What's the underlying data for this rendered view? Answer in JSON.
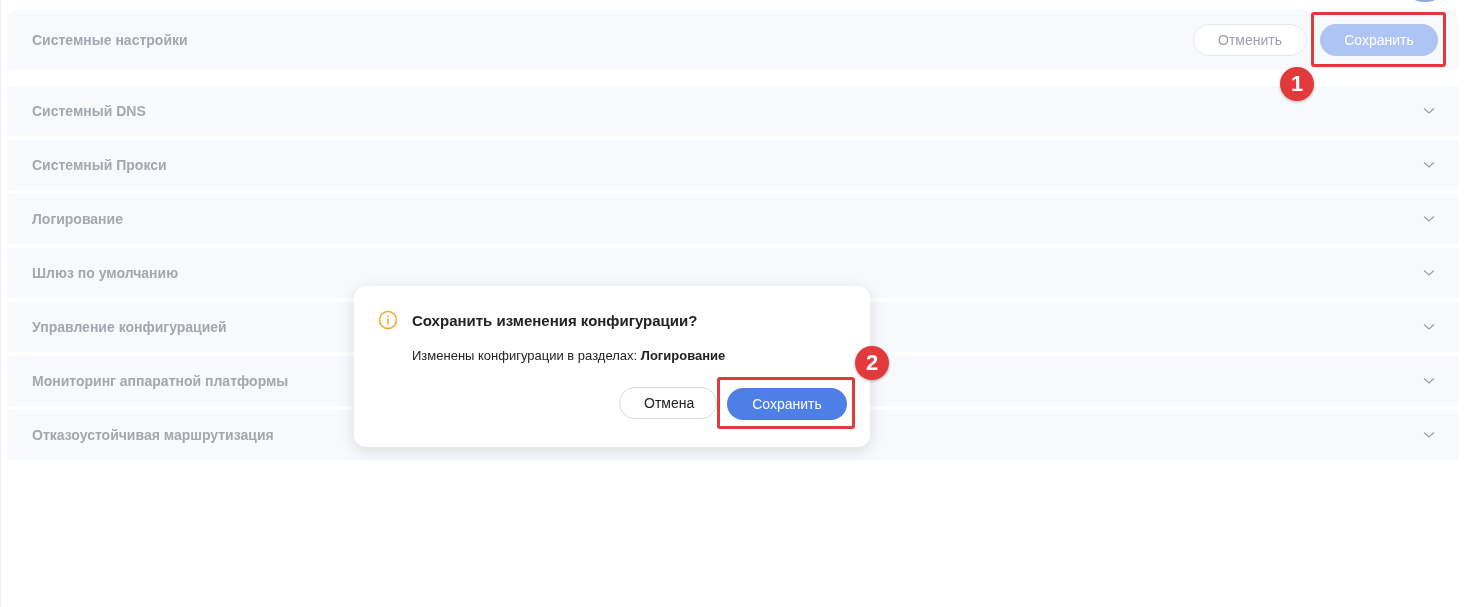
{
  "header": {
    "title": "Системные настройки",
    "cancel_button": "Отменить",
    "save_button": {
      "label": "Сохранить",
      "disabled": true
    }
  },
  "sections": [
    {
      "title": "Системный DNS",
      "expanded": false
    },
    {
      "title": "Системный Прокси",
      "expanded": false
    },
    {
      "title": "Логирование",
      "expanded": false
    },
    {
      "title": "Шлюз по умолчанию",
      "expanded": false
    },
    {
      "title": "Управление конфигурацией",
      "expanded": false
    },
    {
      "title": "Мониторинг аппаратной платформы",
      "expanded": false
    },
    {
      "title": "Отказоустойчивая маршрутизация",
      "expanded": false
    }
  ],
  "dialog": {
    "title": "Сохранить изменения конфигурации?",
    "message": "Изменены конфигурации в разделах: **Логирование**",
    "cancel_button": "Отмена",
    "confirm_button": "Сохранить"
  },
  "annotations": [
    {
      "label": "1"
    },
    {
      "label": "2"
    }
  ]
}
